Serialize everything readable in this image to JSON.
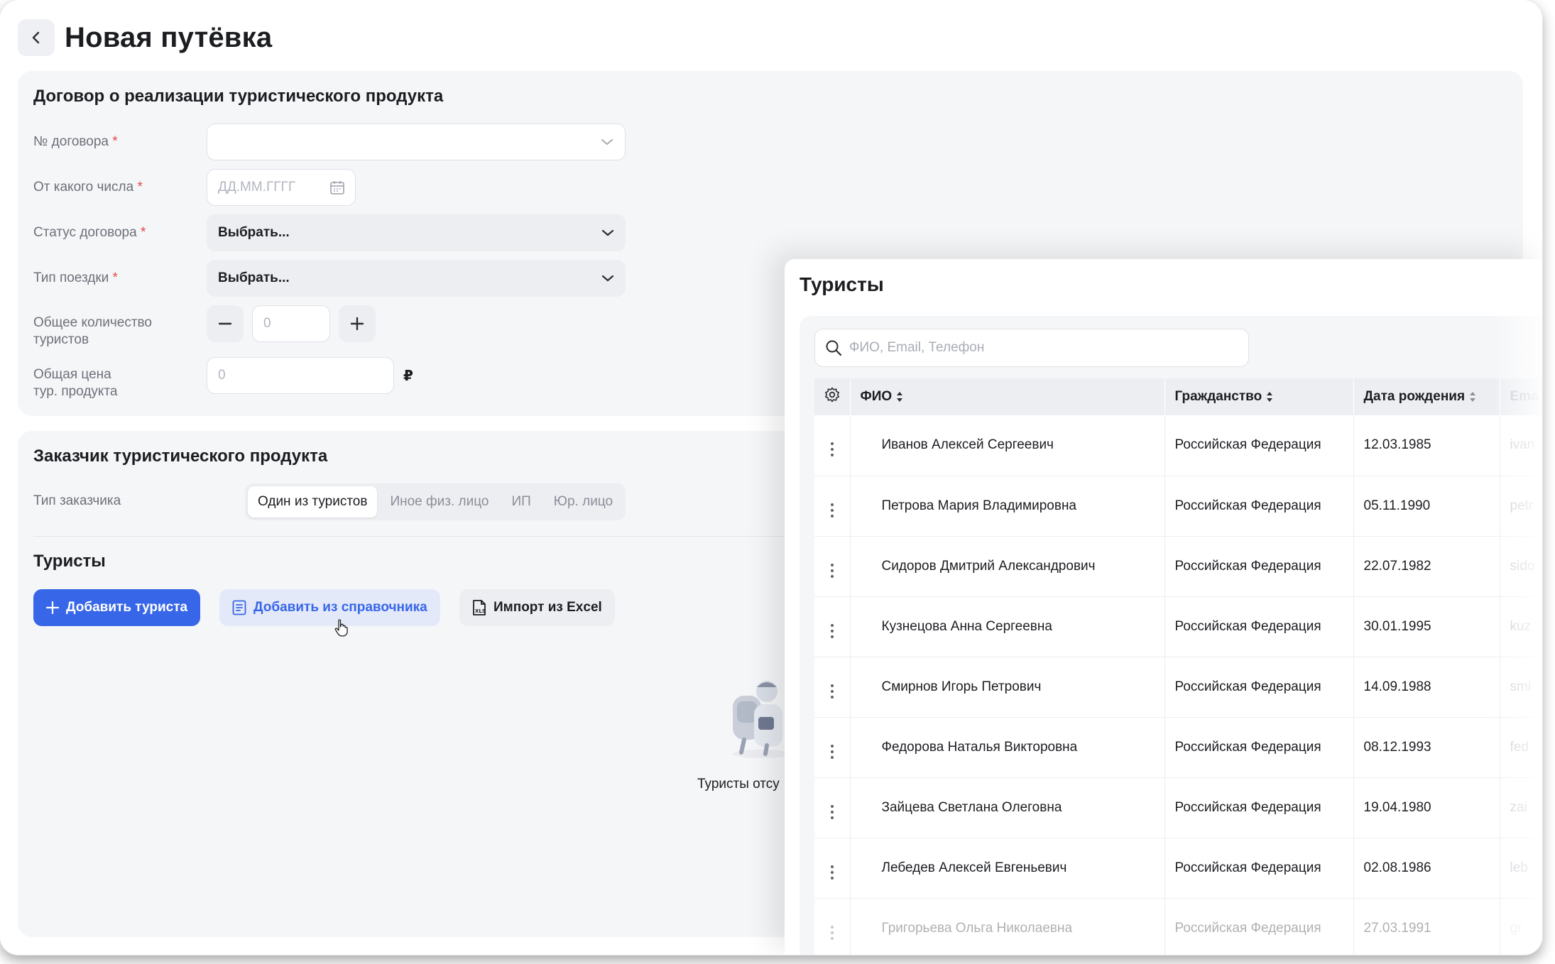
{
  "page": {
    "title": "Новая путёвка"
  },
  "contract": {
    "title": "Договор о реализации туристического продукта",
    "number_label": "№ договора",
    "date_label": "От какого числа",
    "date_placeholder": "ДД.ММ.ГГГГ",
    "status_label": "Статус договора",
    "status_value": "Выбрать...",
    "trip_type_label": "Тип поездки",
    "trip_type_value": "Выбрать...",
    "tourists_count_label_1": "Общее количество",
    "tourists_count_label_2": "туристов",
    "tourists_count_value": "0",
    "price_label_1": "Общая цена",
    "price_label_2": "тур. продукта",
    "price_value": "0",
    "currency": "₽",
    "required_mark": "*"
  },
  "customer": {
    "title": "Заказчик туристического продукта",
    "type_label": "Тип заказчика",
    "types": [
      "Один из туристов",
      "Иное физ. лицо",
      "ИП",
      "Юр. лицо"
    ],
    "active_type": "Один из туристов"
  },
  "tourists": {
    "title": "Туристы",
    "add_button": "Добавить туриста",
    "add_from_directory_button": "Добавить из справочника",
    "import_button": "Импорт из Excel",
    "empty_text": "Туристы отсу"
  },
  "panel": {
    "title": "Туристы",
    "search_placeholder": "ФИО, Email, Телефон",
    "columns": {
      "name": "ФИО",
      "citizenship": "Гражданство",
      "birth_date": "Дата рождения",
      "email": "Ema"
    },
    "rows": [
      {
        "name": "Иванов Алексей Сергеевич",
        "citizenship": "Российская Федерация",
        "birth_date": "12.03.1985",
        "email": "ivan"
      },
      {
        "name": "Петрова Мария Владимировна",
        "citizenship": "Российская Федерация",
        "birth_date": "05.11.1990",
        "email": "petr"
      },
      {
        "name": "Сидоров Дмитрий Александрович",
        "citizenship": "Российская Федерация",
        "birth_date": "22.07.1982",
        "email": "sido"
      },
      {
        "name": "Кузнецова Анна Сергеевна",
        "citizenship": "Российская Федерация",
        "birth_date": "30.01.1995",
        "email": "kuz"
      },
      {
        "name": "Смирнов Игорь Петрович",
        "citizenship": "Российская Федерация",
        "birth_date": "14.09.1988",
        "email": "smi"
      },
      {
        "name": "Федорова Наталья Викторовна",
        "citizenship": "Российская Федерация",
        "birth_date": "08.12.1993",
        "email": "fed"
      },
      {
        "name": "Зайцева Светлана Олеговна",
        "citizenship": "Российская Федерация",
        "birth_date": "19.04.1980",
        "email": "zai"
      },
      {
        "name": "Лебедев Алексей Евгеньевич",
        "citizenship": "Российская Федерация",
        "birth_date": "02.08.1986",
        "email": "leb"
      },
      {
        "name": "Григорьева Ольга Николаевна",
        "citizenship": "Российская Федерация",
        "birth_date": "27.03.1991",
        "email": "gr"
      }
    ]
  },
  "colors": {
    "accent": "#3766e8",
    "accent_soft": "#e4e9f9",
    "required": "#e5484d",
    "section_bg": "#f5f6f8"
  }
}
